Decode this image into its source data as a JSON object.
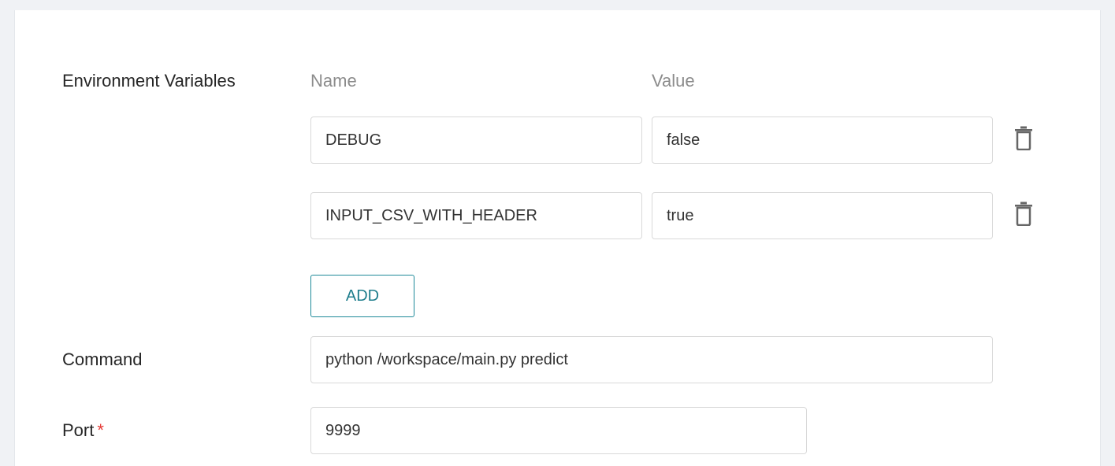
{
  "env_section": {
    "label": "Environment Variables",
    "name_header": "Name",
    "value_header": "Value",
    "rows": [
      {
        "name": "DEBUG",
        "value": "false"
      },
      {
        "name": "INPUT_CSV_WITH_HEADER",
        "value": "true"
      }
    ],
    "add_label": "ADD",
    "delete_icon": "trash-icon"
  },
  "command": {
    "label": "Command",
    "value": "python /workspace/main.py predict"
  },
  "port": {
    "label": "Port",
    "required_mark": "*",
    "value": "9999"
  },
  "colors": {
    "accent": "#1e8a99",
    "required": "#e53935"
  }
}
